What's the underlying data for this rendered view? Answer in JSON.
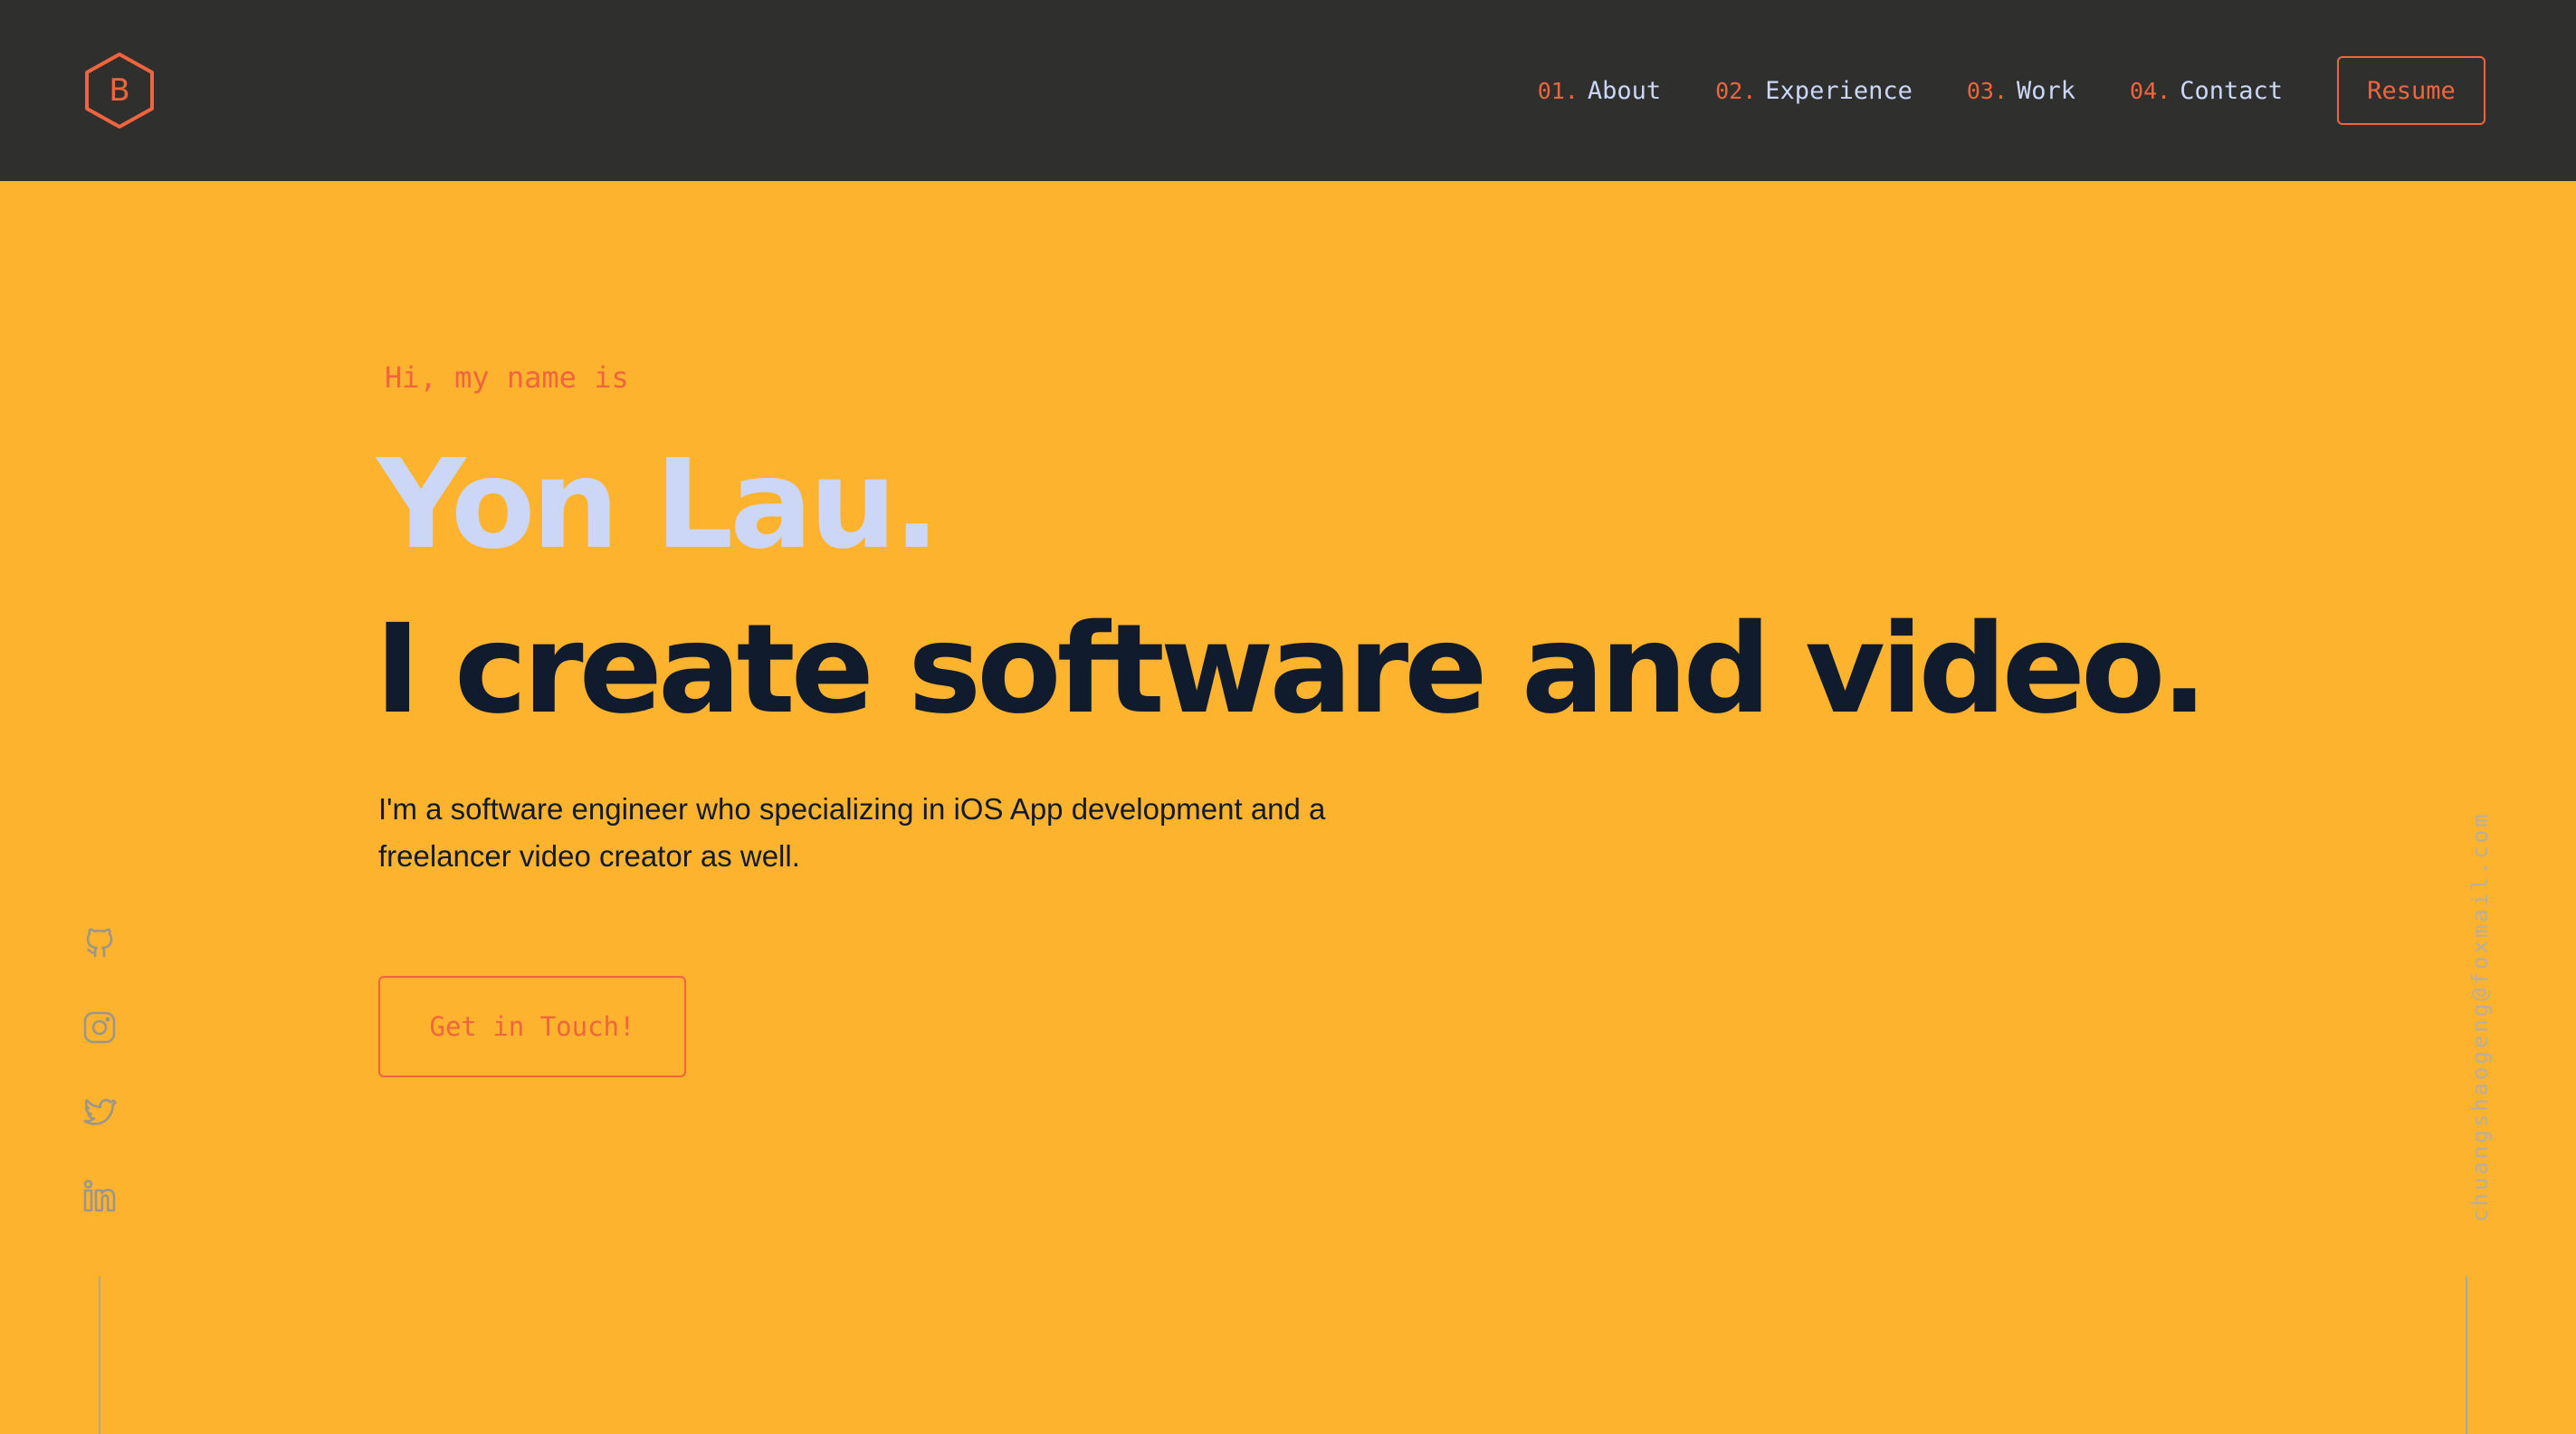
{
  "header": {
    "logo_letter": "B",
    "nav": [
      {
        "number": "01.",
        "label": "About"
      },
      {
        "number": "02.",
        "label": "Experience"
      },
      {
        "number": "03.",
        "label": "Work"
      },
      {
        "number": "04.",
        "label": "Contact"
      }
    ],
    "resume_label": "Resume"
  },
  "hero": {
    "greeting": "Hi, my name is",
    "name": "Yon Lau.",
    "tagline": "I create software and video.",
    "description": "I'm a software engineer who specializing in iOS App development and a freelancer video creator as well.",
    "cta_label": "Get in Touch!"
  },
  "social": {
    "icons": [
      "github-icon",
      "instagram-icon",
      "twitter-icon",
      "linkedin-icon"
    ]
  },
  "side": {
    "email": "chuangshaogeng@foxmail.com"
  },
  "colors": {
    "header_bg": "#2F302E",
    "page_bg": "#FDB32E",
    "accent": "#F0653E",
    "name_text": "#CCD6F6",
    "heading_text": "#111B2E",
    "muted": "#A9A8A4"
  }
}
